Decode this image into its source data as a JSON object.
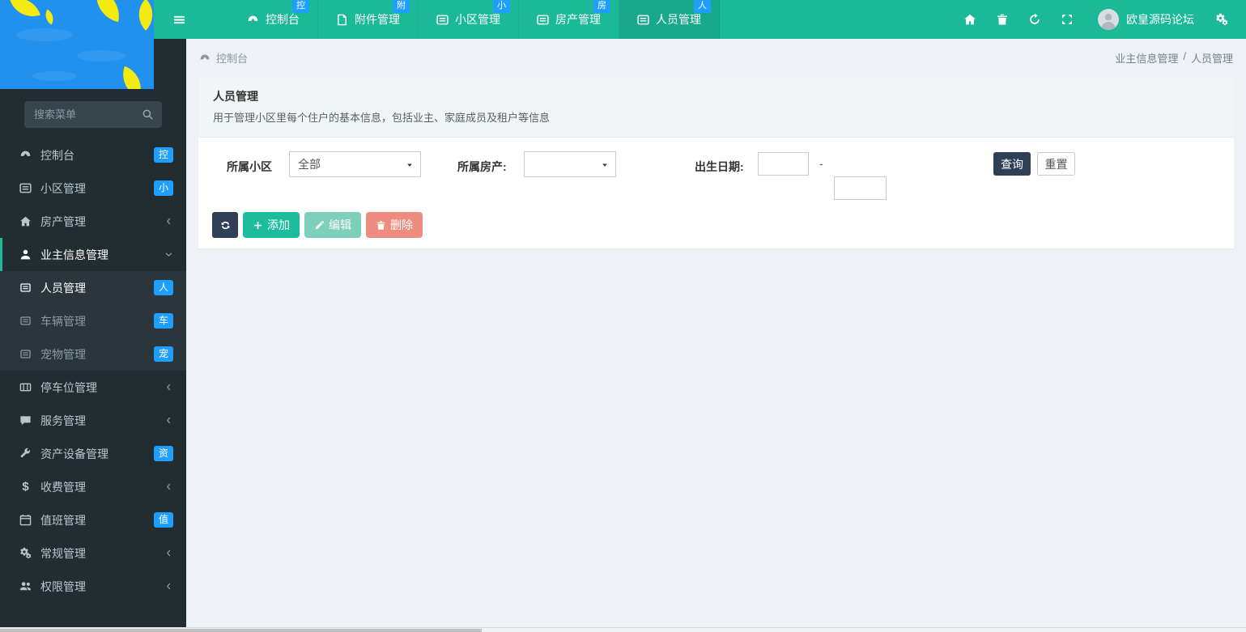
{
  "theme": {
    "navbar_green": "#1bb998",
    "navbar_active_tab": "#18a88c",
    "sidebar_dark": "#222d32",
    "submenu_dark": "#2a363c",
    "badge_blue": "#1e9fff",
    "navy_button": "#2f4056",
    "green_button": "#1dbc9d",
    "green_disabled_button": "#7ecfb9",
    "red_button": "#ee8c7f",
    "logo_blue": "#2191ef",
    "leaf_yellow": "#f2ea10",
    "page_bg": "#eef1f5"
  },
  "navbar": {
    "menu_icon": "menu-icon",
    "tabs": [
      {
        "label": "控制台",
        "badge": "控",
        "icon": "gauge-icon",
        "active": false
      },
      {
        "label": "附件管理",
        "badge": "附",
        "icon": "file-icon",
        "active": false
      },
      {
        "label": "小区管理",
        "badge": "小",
        "icon": "form-icon",
        "active": false
      },
      {
        "label": "房产管理",
        "badge": "房",
        "icon": "form-icon",
        "active": false
      },
      {
        "label": "人员管理",
        "badge": "人",
        "icon": "form-icon",
        "active": true
      }
    ],
    "right_icons": [
      "home-icon",
      "trash-icon",
      "clear-cache-icon",
      "fullscreen-icon"
    ],
    "user": {
      "name": "欧皇源码论坛",
      "avatar_icon": "user-avatar"
    },
    "settings_icon": "settings-icon"
  },
  "sidebar": {
    "search_placeholder": "搜索菜单",
    "search_icon": "search-icon",
    "items": [
      {
        "label": "控制台",
        "icon": "gauge-icon",
        "badge": "控"
      },
      {
        "label": "小区管理",
        "icon": "form-icon",
        "badge": "小"
      },
      {
        "label": "房产管理",
        "icon": "home-icon",
        "chevron": "left"
      },
      {
        "label": "业主信息管理",
        "icon": "user-icon",
        "chevron": "down",
        "open": true,
        "children": [
          {
            "label": "人员管理",
            "icon": "form-icon",
            "badge": "人",
            "active": true
          },
          {
            "label": "车辆管理",
            "icon": "form-icon",
            "badge": "车",
            "active": false
          },
          {
            "label": "宠物管理",
            "icon": "form-icon",
            "badge": "宠",
            "active": false
          }
        ]
      },
      {
        "label": "停车位管理",
        "icon": "parking-icon",
        "chevron": "left"
      },
      {
        "label": "服务管理",
        "icon": "chat-icon",
        "chevron": "left"
      },
      {
        "label": "资产设备管理",
        "icon": "wrench-icon",
        "badge": "资"
      },
      {
        "label": "收费管理",
        "icon": "dollar-icon",
        "chevron": "left"
      },
      {
        "label": "值班管理",
        "icon": "calendar-icon",
        "badge": "值"
      },
      {
        "label": "常规管理",
        "icon": "cogs-icon",
        "chevron": "left"
      },
      {
        "label": "权限管理",
        "icon": "users-icon",
        "chevron": "left"
      }
    ]
  },
  "breadcrumb": {
    "left_icon": "gauge-icon",
    "left": "控制台",
    "right_parent": "业主信息管理",
    "separator": "/",
    "right_current": "人员管理"
  },
  "page": {
    "title": "人员管理",
    "subtitle": "用于管理小区里每个住户的基本信息，包括业主、家庭成员及租户等信息"
  },
  "filters": {
    "community_label": "所属小区",
    "community_value": "全部",
    "property_label": "所属房产:",
    "property_value": "",
    "birthdate_label": "出生日期:",
    "date_from": "",
    "date_to": "",
    "range_separator": "-",
    "search_button": "查询",
    "reset_button": "重置"
  },
  "toolbar": {
    "refresh_icon": "refresh-icon",
    "add": "添加",
    "edit": "编辑",
    "delete": "删除"
  }
}
